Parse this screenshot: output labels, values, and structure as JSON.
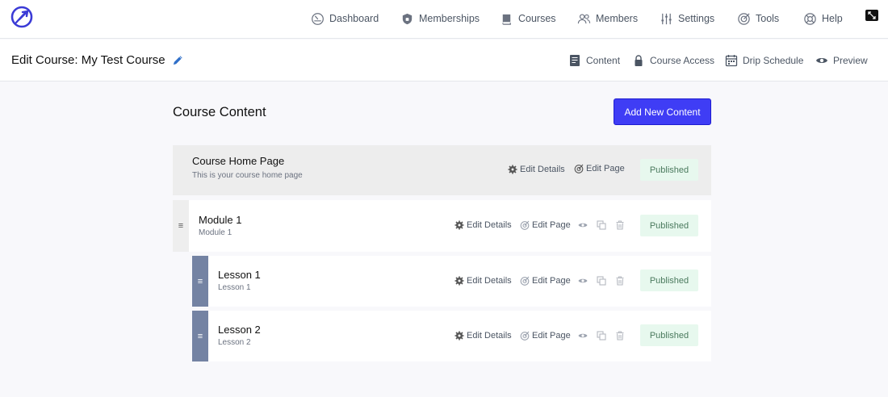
{
  "nav": {
    "logo_icon": "rocket-logo-icon",
    "items": [
      {
        "label": "Dashboard",
        "icon": "gauge-icon"
      },
      {
        "label": "Memberships",
        "icon": "shield-icon"
      },
      {
        "label": "Courses",
        "icon": "book-icon"
      },
      {
        "label": "Members",
        "icon": "users-icon"
      },
      {
        "label": "Settings",
        "icon": "sliders-icon"
      },
      {
        "label": "Tools",
        "icon": "target-icon"
      },
      {
        "label": "Help",
        "icon": "lifebuoy-icon"
      }
    ]
  },
  "subheader": {
    "title": "Edit Course: My Test Course",
    "tabs": [
      {
        "label": "Content",
        "icon": "document-icon"
      },
      {
        "label": "Course Access",
        "icon": "lock-icon"
      },
      {
        "label": "Drip Schedule",
        "icon": "calendar-icon"
      },
      {
        "label": "Preview",
        "icon": "eye-icon"
      }
    ]
  },
  "content": {
    "section_title": "Course Content",
    "add_button": "Add New Content",
    "edit_details_label": "Edit Details",
    "edit_page_label": "Edit Page",
    "handle_glyph": "≡",
    "items": [
      {
        "title": "Course Home Page",
        "subtitle": "This is your course home page",
        "status": "Published"
      },
      {
        "title": "Module 1",
        "subtitle": "Module 1",
        "status": "Published"
      },
      {
        "title": "Lesson 1",
        "subtitle": "Lesson 1",
        "status": "Published"
      },
      {
        "title": "Lesson 2",
        "subtitle": "Lesson 2",
        "status": "Published"
      }
    ]
  },
  "colors": {
    "accent": "#3f3df5",
    "logo": "#3b3bd6",
    "pencil": "#2f6fc9",
    "published_bg": "#e7f8ee",
    "published_text": "#4b7a5e",
    "handle_slate": "#7483a3"
  }
}
